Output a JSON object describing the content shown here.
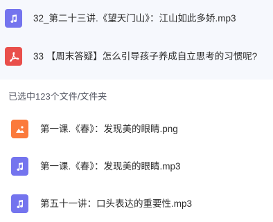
{
  "top_files": [
    {
      "name": "32_第二十三讲.《望天门山》：江山如此多娇.mp3",
      "icon": "music-icon",
      "color": "#7474ee"
    },
    {
      "name": "33 【周末答疑】怎么引导孩子养成自立思考的习惯呢?",
      "icon": "pdf-icon",
      "color": "#e94f4b"
    }
  ],
  "selection": {
    "status": "已选中123个文件/文件夹"
  },
  "selected_files": [
    {
      "name": "第一课.《春》：发现美的眼睛.png",
      "icon": "image-icon",
      "color": "#fb7a3c"
    },
    {
      "name": "第一课.《春》：发现美的眼睛.mp3",
      "icon": "music-icon",
      "color": "#7474ee"
    },
    {
      "name": "第五十一讲：口头表达的重要性.mp3",
      "icon": "music-icon",
      "color": "#7474ee"
    }
  ]
}
